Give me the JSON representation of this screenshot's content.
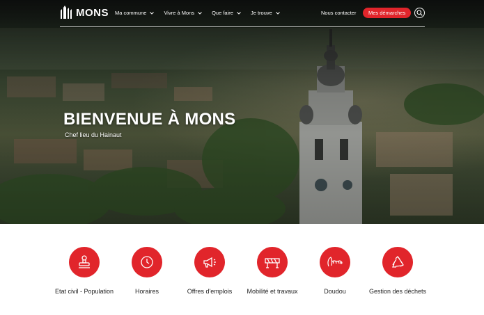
{
  "brand": {
    "name": "MONS",
    "accent": "#e1252b"
  },
  "nav": {
    "items": [
      {
        "label": "Ma commune"
      },
      {
        "label": "Vivre à Mons"
      },
      {
        "label": "Que faire"
      },
      {
        "label": "Je trouve"
      }
    ],
    "contact_label": "Nous contacter",
    "cta_label": "Mes démarches",
    "search_icon": "search-icon"
  },
  "hero": {
    "title": "BIENVENUE À MONS",
    "subtitle": "Chef lieu du Hainaut"
  },
  "services": [
    {
      "label": "Etat civil - Population",
      "icon": "stamp-icon"
    },
    {
      "label": "Horaires",
      "icon": "clock-icon"
    },
    {
      "label": "Offres d'emplois",
      "icon": "megaphone-icon"
    },
    {
      "label": "Mobilité et travaux",
      "icon": "road-barrier-icon"
    },
    {
      "label": "Doudou",
      "icon": "dragon-icon"
    },
    {
      "label": "Gestion des déchets",
      "icon": "recycle-icon"
    }
  ]
}
